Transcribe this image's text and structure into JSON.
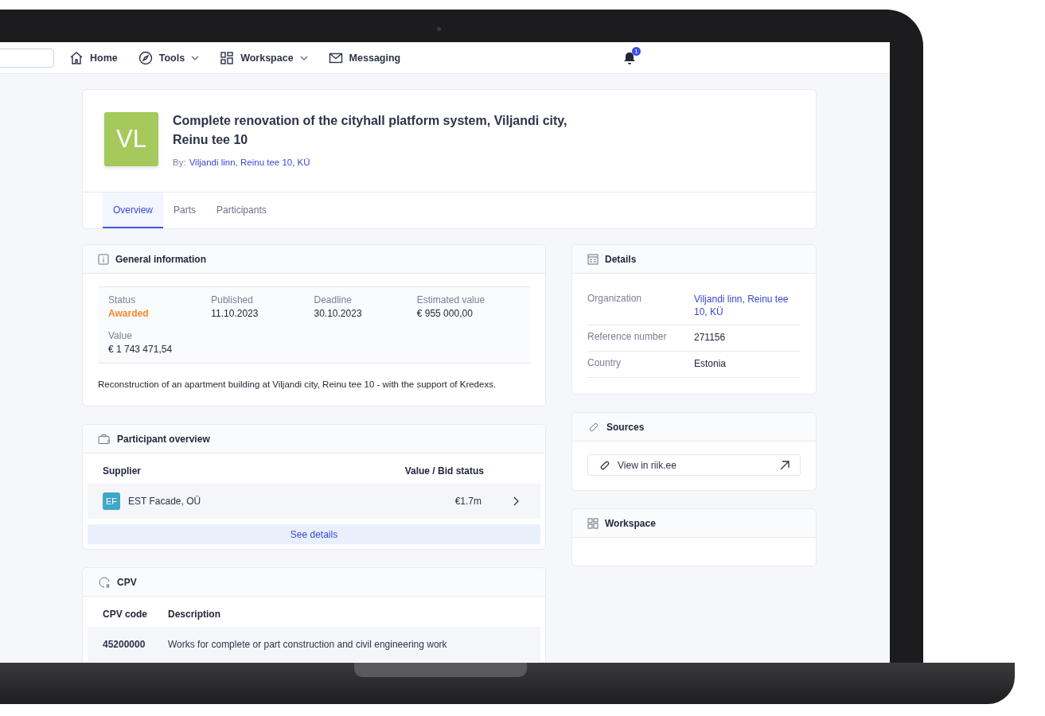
{
  "nav": {
    "items": [
      {
        "label": "Home",
        "has_menu": false
      },
      {
        "label": "Tools",
        "has_menu": true
      },
      {
        "label": "Workspace",
        "has_menu": true
      },
      {
        "label": "Messaging",
        "has_menu": false
      }
    ],
    "notifications": "1"
  },
  "header": {
    "initials": "VL",
    "title": "Complete renovation of the cityhall platform system, Viljandi city, Reinu tee 10",
    "by_label": "By:",
    "by_link": "Viljandi linn, Reinu tee 10, KÜ",
    "tabs": [
      {
        "label": "Overview",
        "selected": true
      },
      {
        "label": "Parts",
        "selected": false
      },
      {
        "label": "Participants",
        "selected": false
      }
    ]
  },
  "general_information": {
    "title": "General information",
    "fields": [
      {
        "label": "Status",
        "value": "Awarded",
        "kind": "status"
      },
      {
        "label": "Published",
        "value": "11.10.2023",
        "kind": "plain"
      },
      {
        "label": "Deadline",
        "value": "30.10.2023",
        "kind": "plain"
      },
      {
        "label": "Estimated value",
        "value": "€ 955 000,00",
        "kind": "plain"
      },
      {
        "label": "Value",
        "value": "€ 1 743 471,54",
        "kind": "plain"
      }
    ],
    "description": "Reconstruction of an apartment building at Viljandi city, Reinu tee 10 - with the support of Kredexs."
  },
  "participant_overview": {
    "title": "Participant overview",
    "columns": [
      "Supplier",
      "Value / Bid status"
    ],
    "rows": [
      {
        "initials": "EF",
        "name": "EST Facade, OÜ",
        "value": "€1.7m"
      }
    ],
    "button": "See details"
  },
  "cpv": {
    "title": "CPV",
    "columns": [
      "CPV code",
      "Description"
    ],
    "rows": [
      {
        "code": "45200000",
        "description": "Works for complete or part construction and civil engineering work"
      }
    ]
  },
  "details": {
    "title": "Details",
    "rows": [
      {
        "label": "Organization",
        "value": "Viljandi linn, Reinu tee 10, KÜ",
        "link": true
      },
      {
        "label": "Reference number",
        "value": "271156",
        "link": false
      },
      {
        "label": "Country",
        "value": "Estonia",
        "link": false
      }
    ]
  },
  "sources": {
    "title": "Sources",
    "link": "View in riik.ee"
  },
  "workspace": {
    "title": "Workspace"
  }
}
